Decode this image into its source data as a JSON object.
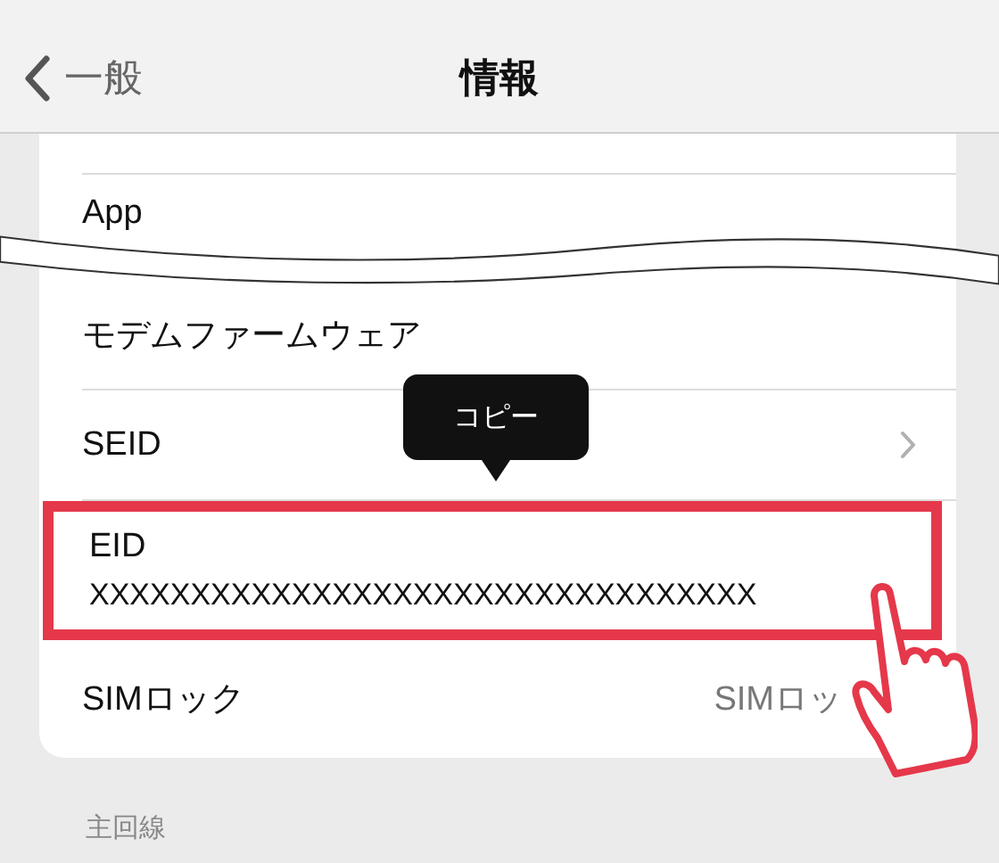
{
  "nav": {
    "back_label": "一般",
    "title": "情報"
  },
  "rows": [
    {
      "kind": "plain",
      "label": "App",
      "highlighted": false
    },
    {
      "kind": "plain",
      "label": "モデムファームウェア",
      "highlighted": false
    },
    {
      "kind": "link",
      "label": "SEID",
      "highlighted": false
    },
    {
      "kind": "detail",
      "label": "EID",
      "value": "XXXXXXXXXXXXXXXXXXXXXXXXXXXXXXXXX",
      "highlighted": true
    },
    {
      "kind": "value",
      "label": "SIMロック",
      "value": "SIMロッ",
      "highlighted": false
    }
  ],
  "tooltip": {
    "label": "コピー"
  },
  "section_header": "主回線"
}
